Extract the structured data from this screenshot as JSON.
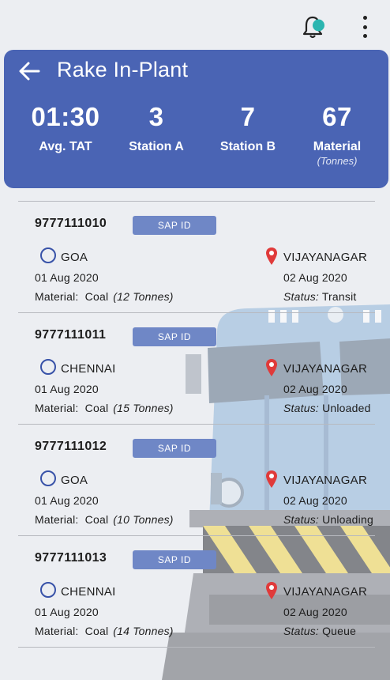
{
  "header": {
    "title": "Rake In-Plant",
    "stats": [
      {
        "value": "01:30",
        "label": "Avg. TAT",
        "sub": ""
      },
      {
        "value": "3",
        "label": "Station A",
        "sub": ""
      },
      {
        "value": "7",
        "label": "Station B",
        "sub": ""
      },
      {
        "value": "67",
        "label": "Material",
        "sub": "(Tonnes)"
      }
    ]
  },
  "icons": {
    "notification": "bell-icon",
    "menu": "more-vertical-icon",
    "back": "arrow-left-icon",
    "origin": "circle-outline-icon",
    "destination": "map-pin-icon"
  },
  "colors": {
    "header_bg": "#4a64b4",
    "sap_button": "#6f87c6",
    "notification_dot": "#2bb5b0",
    "origin_ring": "#3852a8",
    "pin": "#e03a3a"
  },
  "labels": {
    "material": "Material:",
    "status": "Status:"
  },
  "rakes": [
    {
      "id": "9777111010",
      "sap_label": "SAP ID",
      "from": "GOA",
      "from_date": "01 Aug 2020",
      "to": "VIJAYANAGAR",
      "to_date": "02 Aug 2020",
      "material": "Coal",
      "tonnes": "(12 Tonnes)",
      "status": "Transit"
    },
    {
      "id": "9777111011",
      "sap_label": "SAP ID",
      "from": "CHENNAI",
      "from_date": "01 Aug 2020",
      "to": "VIJAYANAGAR",
      "to_date": "02 Aug 2020",
      "material": "Coal",
      "tonnes": "(15 Tonnes)",
      "status": "Unloaded"
    },
    {
      "id": "9777111012",
      "sap_label": "SAP ID",
      "from": "GOA",
      "from_date": "01 Aug 2020",
      "to": "VIJAYANAGAR",
      "to_date": "02 Aug 2020",
      "material": "Coal",
      "tonnes": "(10 Tonnes)",
      "status": "Unloading"
    },
    {
      "id": "9777111013",
      "sap_label": "SAP ID",
      "from": "CHENNAI",
      "from_date": "01 Aug 2020",
      "to": "VIJAYANAGAR",
      "to_date": "02 Aug 2020",
      "material": "Coal",
      "tonnes": "(14 Tonnes)",
      "status": "Queue"
    }
  ]
}
